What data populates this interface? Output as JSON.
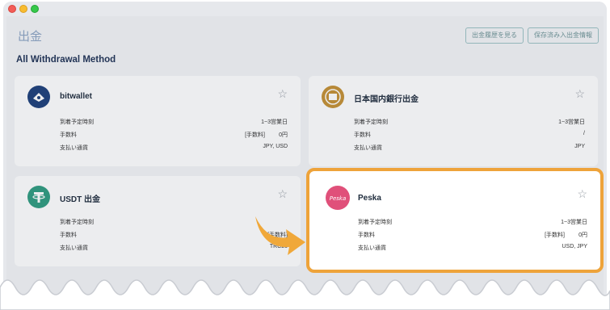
{
  "header": {
    "title": "出金",
    "history_button": "出金履歴を見る",
    "saved_button": "保存済み入出金情報"
  },
  "section_title": "All Withdrawal Method",
  "cards": {
    "bitwallet": {
      "name": "bitwallet",
      "rows": [
        {
          "label": "到着予定時刻",
          "value": "1~3営業日"
        },
        {
          "label": "手数料",
          "tag": "[手数料]",
          "value": "0円"
        },
        {
          "label": "支払い通貨",
          "value": "JPY, USD"
        }
      ]
    },
    "bank": {
      "name": "日本国内銀行出金",
      "rows": [
        {
          "label": "到着予定時刻",
          "value": "1~3営業日"
        },
        {
          "label": "手数料",
          "value": "/"
        },
        {
          "label": "支払い通貨",
          "value": "JPY"
        }
      ]
    },
    "usdt": {
      "name": "USDT 出金",
      "rows": [
        {
          "label": "到着予定時刻",
          "value": ""
        },
        {
          "label": "手数料",
          "tag": "[手数料]",
          "value": ""
        },
        {
          "label": "支払い通貨",
          "value": "TRC20"
        }
      ]
    },
    "peska": {
      "name": "Peska",
      "logo_text": "Peska",
      "rows": [
        {
          "label": "到着予定時刻",
          "value": "1~3営業日"
        },
        {
          "label": "手数料",
          "tag": "[手数料]",
          "value": "0円"
        },
        {
          "label": "支払い通貨",
          "value": "USD, JPY"
        }
      ]
    }
  },
  "icons": {
    "star": "star-outline-icon",
    "window_controls": [
      "close-dot",
      "minimize-dot",
      "maximize-dot"
    ]
  },
  "colors": {
    "highlight_border": "#eea33a",
    "title_text": "#1f3255",
    "peska_brand": "#e0507a",
    "bank_brand": "#c49034",
    "usdt_brand": "#2e9b7f",
    "bitwallet_brand": "#1c3f7a"
  }
}
